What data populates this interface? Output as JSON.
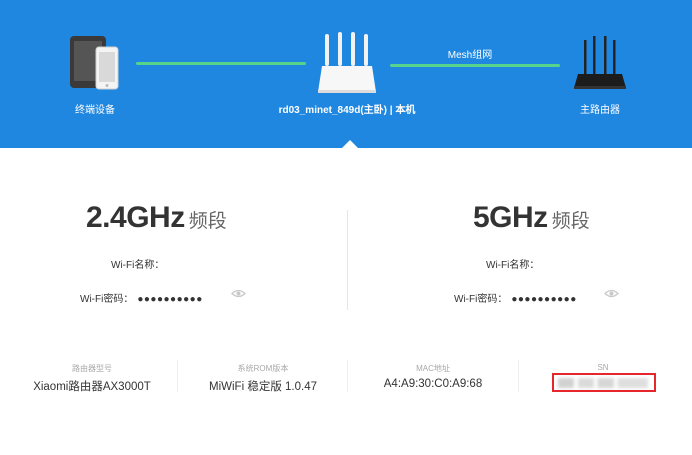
{
  "topology": {
    "terminal_label": "终端设备",
    "router_label": "rd03_minet_849d(主卧) | 本机",
    "mesh_label": "Mesh组网",
    "main_router_label": "主路由器"
  },
  "bands": [
    {
      "freq": "2.4GHz",
      "suffix": "频段",
      "wifi_name_label": "Wi-Fi名称：",
      "wifi_name_value": "",
      "wifi_password_label": "Wi-Fi密码：",
      "wifi_password_value": "●●●●●●●●●●"
    },
    {
      "freq": "5GHz",
      "suffix": "频段",
      "wifi_name_label": "Wi-Fi名称：",
      "wifi_name_value": "",
      "wifi_password_label": "Wi-Fi密码：",
      "wifi_password_value": "●●●●●●●●●●"
    }
  ],
  "info": {
    "model_label": "路由器型号",
    "model_value": "Xiaomi路由器AX3000T",
    "rom_label": "系统ROM版本",
    "rom_value": "MiWiFi 稳定版 1.0.47",
    "mac_label": "MAC地址",
    "mac_value": "A4:A9:30:C0:A9:68",
    "sn_label": "SN"
  },
  "colors": {
    "banner": "#1f87e0",
    "link": "#58d38b",
    "highlight": "#e5262c"
  },
  "icons": [
    "tablet-phone-icon",
    "router-icon",
    "main-router-icon",
    "eye-icon"
  ]
}
